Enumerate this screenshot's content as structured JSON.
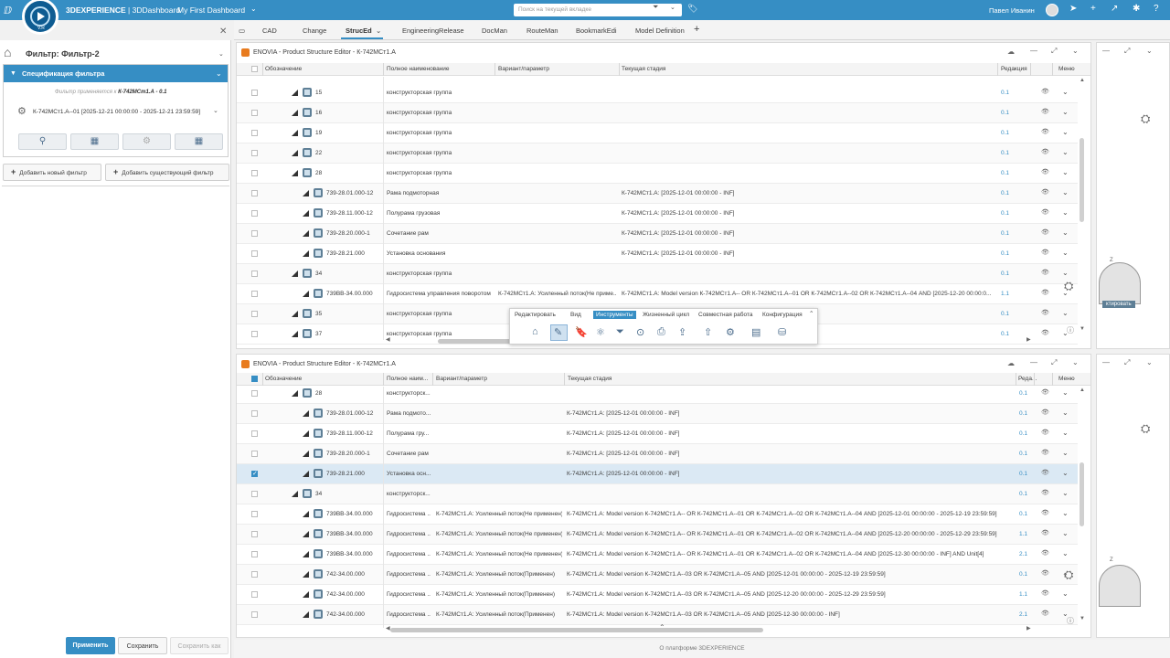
{
  "topbar": {
    "brand_bold": "3DEXPERIENCE",
    "brand_rest": " | 3DDashboard",
    "dashboard_title": "My First Dashboard",
    "search_placeholder": "Поиск на текущей вкладке",
    "user_name": "Павел Иванин",
    "logo_version": "V.R"
  },
  "tabs": [
    "CAD",
    "Change",
    "StrucEd",
    "EngineeringRelease",
    "DocMan",
    "RouteMan",
    "BookmarkEdi",
    "Model Definition"
  ],
  "active_tab": "StrucEd",
  "filter_panel": {
    "title": "Фильтр: Фильтр-2",
    "spec_header": "Спецификация фильтра",
    "applied_prefix": "Фильтр применяется к",
    "applied_object": "К-742МСт1.А - 0.1",
    "expression": "К-742МСт1.А--01 [2025-12-21 00:00:00 - 2025-12-21 23:59:59]",
    "add_new_label": "Добавить новый фильтр",
    "add_existing_label": "Добавить существующий фильтр",
    "apply_label": "Применить",
    "save_label": "Сохранить",
    "save_as_label": "Сохранить как"
  },
  "panel_top": {
    "title": "ENOVIA - Product Structure Editor - К-742МСт1.А",
    "headers": [
      "Обозначение",
      "Полное наименование",
      "Вариант/параметр",
      "Текущая стадия",
      "Редакция",
      "Меню"
    ],
    "rows": [
      {
        "level": 1,
        "name": "15",
        "full": "конструкторская группа",
        "variant": "",
        "stage": "",
        "rev": "0.1"
      },
      {
        "level": 1,
        "name": "16",
        "full": "конструкторская группа",
        "variant": "",
        "stage": "",
        "rev": "0.1"
      },
      {
        "level": 1,
        "name": "19",
        "full": "конструкторская группа",
        "variant": "",
        "stage": "",
        "rev": "0.1"
      },
      {
        "level": 1,
        "name": "22",
        "full": "конструкторская группа",
        "variant": "",
        "stage": "",
        "rev": "0.1"
      },
      {
        "level": 1,
        "name": "28",
        "full": "конструкторская группа",
        "variant": "",
        "stage": "",
        "rev": "0.1"
      },
      {
        "level": 2,
        "name": "739-28.01.000-12",
        "full": "Рама подмоторная",
        "variant": "",
        "stage": "К-742МСт1.А: [2025-12-01 00:00:00 - INF]",
        "rev": "0.1"
      },
      {
        "level": 2,
        "name": "739-28.11.000-12",
        "full": "Полурама грузовая",
        "variant": "",
        "stage": "К-742МСт1.А: [2025-12-01 00:00:00 - INF]",
        "rev": "0.1"
      },
      {
        "level": 2,
        "name": "739-28.20.000-1",
        "full": "Сочетание рам",
        "variant": "",
        "stage": "К-742МСт1.А: [2025-12-01 00:00:00 - INF]",
        "rev": "0.1"
      },
      {
        "level": 2,
        "name": "739-28.21.000",
        "full": "Установка основания",
        "variant": "",
        "stage": "К-742МСт1.А: [2025-12-01 00:00:00 - INF]",
        "rev": "0.1"
      },
      {
        "level": 1,
        "name": "34",
        "full": "конструкторская группа",
        "variant": "",
        "stage": "",
        "rev": "0.1"
      },
      {
        "level": 2,
        "name": "739ВВ-34.00.000",
        "full": "Гидросистема управления поворотом",
        "variant": "К-742МСт1.А: Усиленный поток(Не приме...",
        "stage": "К-742МСт1.А: Model version К-742МСт1.А--  OR К-742МСт1.А--01  OR К-742МСт1.А--02  OR К-742МСт1.А--04  AND [2025-12-20 00:00:0...",
        "rev": "1.1"
      },
      {
        "level": 1,
        "name": "35",
        "full": "конструкторская группа",
        "variant": "",
        "stage": "",
        "rev": "0.1"
      },
      {
        "level": 1,
        "name": "37",
        "full": "конструкторская группа",
        "variant": "",
        "stage": "",
        "rev": "0.1"
      }
    ]
  },
  "toolbar": {
    "tabs": [
      "Редактировать",
      "Вид",
      "Инструменты",
      "Жизненный цикл",
      "Совместная работа",
      "Конфигурация"
    ],
    "active": "Инструменты"
  },
  "panel_bottom": {
    "title": "ENOVIA - Product Structure Editor - К-742МСт1.А",
    "headers": [
      "Обозначение",
      "Полное наим...",
      "Вариант/параметр",
      "Текущая стадия",
      "Реда...",
      "Меню"
    ],
    "rows": [
      {
        "level": 1,
        "name": "28",
        "full": "конструкторск...",
        "variant": "",
        "stage": "",
        "rev": "0.1",
        "checked": false
      },
      {
        "level": 2,
        "name": "739-28.01.000-12",
        "full": "Рама подмото...",
        "variant": "",
        "stage": "К-742МСт1.А: [2025-12-01 00:00:00 - INF]",
        "rev": "0.1",
        "checked": false
      },
      {
        "level": 2,
        "name": "739-28.11.000-12",
        "full": "Полурама гру...",
        "variant": "",
        "stage": "К-742МСт1.А: [2025-12-01 00:00:00 - INF]",
        "rev": "0.1",
        "checked": false
      },
      {
        "level": 2,
        "name": "739-28.20.000-1",
        "full": "Сочетание рам",
        "variant": "",
        "stage": "К-742МСт1.А: [2025-12-01 00:00:00 - INF]",
        "rev": "0.1",
        "checked": false
      },
      {
        "level": 2,
        "name": "739-28.21.000",
        "full": "Установка осн...",
        "variant": "",
        "stage": "К-742МСт1.А: [2025-12-01 00:00:00 - INF]",
        "rev": "0.1",
        "checked": true
      },
      {
        "level": 1,
        "name": "34",
        "full": "конструкторск...",
        "variant": "",
        "stage": "",
        "rev": "0.1",
        "checked": false
      },
      {
        "level": 2,
        "name": "739ВВ-34.00.000",
        "full": "Гидросистема ...",
        "variant": "К-742МСт1.А: Усиленный поток(Не применен)",
        "stage": "К-742МСт1.А: Model version К-742МСт1.А--  OR К-742МСт1.А--01  OR К-742МСт1.А--02  OR К-742МСт1.А--04  AND [2025-12-01 00:00:00 - 2025-12-19 23:59:59]",
        "rev": "0.1",
        "checked": false
      },
      {
        "level": 2,
        "name": "739ВВ-34.00.000",
        "full": "Гидросистема ...",
        "variant": "К-742МСт1.А: Усиленный поток(Не применен)",
        "stage": "К-742МСт1.А: Model version К-742МСт1.А--  OR К-742МСт1.А--01  OR К-742МСт1.А--02  OR К-742МСт1.А--04  AND [2025-12-20 00:00:00 - 2025-12-29 23:59:59]",
        "rev": "1.1",
        "checked": false
      },
      {
        "level": 2,
        "name": "739ВВ-34.00.000",
        "full": "Гидросистема ...",
        "variant": "К-742МСт1.А: Усиленный поток(Не применен)",
        "stage": "К-742МСт1.А: Model version К-742МСт1.А--  OR К-742МСт1.А--01  OR К-742МСт1.А--02  OR К-742МСт1.А--04  AND [2025-12-30 00:00:00 - INF] AND Unit[4]",
        "rev": "2.1",
        "checked": false
      },
      {
        "level": 2,
        "name": "742-34.00.000",
        "full": "Гидросистема ...",
        "variant": "К-742МСт1.А: Усиленный поток(Применен)",
        "stage": "К-742МСт1.А: Model version К-742МСт1.А--03  OR К-742МСт1.А--05  AND [2025-12-01 00:00:00 - 2025-12-19 23:59:59]",
        "rev": "0.1",
        "checked": false
      },
      {
        "level": 2,
        "name": "742-34.00.000",
        "full": "Гидросистема ...",
        "variant": "К-742МСт1.А: Усиленный поток(Применен)",
        "stage": "К-742МСт1.А: Model version К-742МСт1.А--03  OR К-742МСт1.А--05  AND [2025-12-20 00:00:00 - 2025-12-29 23:59:59]",
        "rev": "1.1",
        "checked": false
      },
      {
        "level": 2,
        "name": "742-34.00.000",
        "full": "Гидросистема ...",
        "variant": "К-742МСт1.А: Усиленный поток(Применен)",
        "stage": "К-742МСт1.А: Model version К-742МСт1.А--03  OR К-742МСт1.А--05  AND [2025-12-30 00:00:00 - INF]",
        "rev": "2.1",
        "checked": false
      }
    ]
  },
  "side": {
    "tag_label": "ктировать"
  },
  "footer": "О платформе 3DEXPERIENCE",
  "colors": {
    "brand_blue": "#368ec4",
    "panel_icon": "#e87b1e",
    "selected_row": "#dbe9f4"
  }
}
